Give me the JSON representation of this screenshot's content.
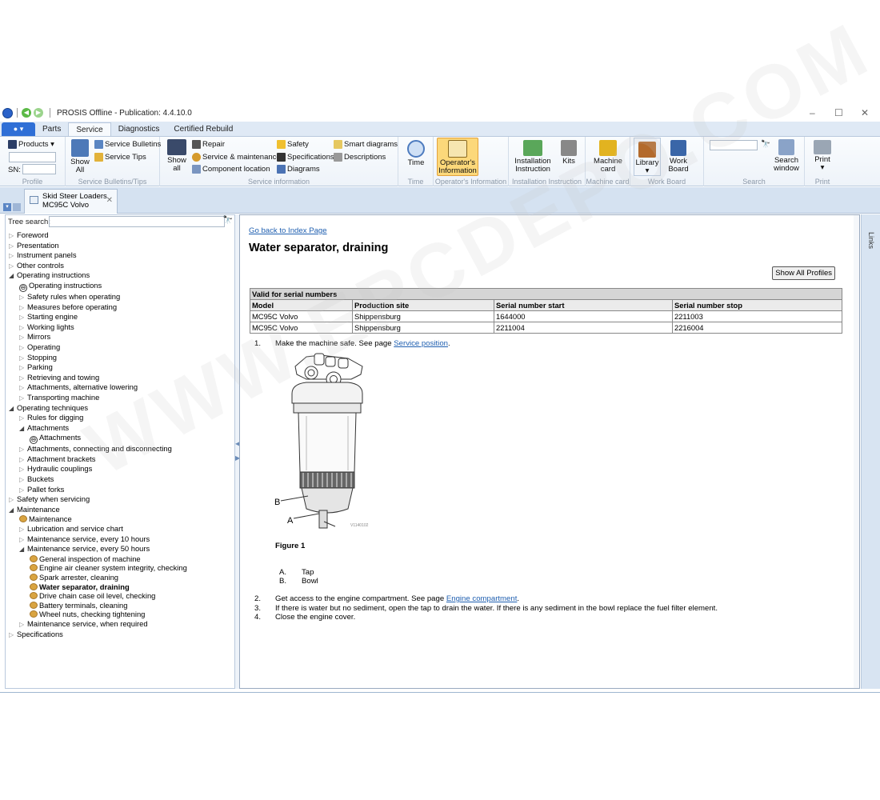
{
  "titlebar": {
    "title": "PROSIS Offline - Publication: 4.4.10.0"
  },
  "menubar": {
    "tabs": [
      "Parts",
      "Service",
      "Diagnostics",
      "Certified Rebuild"
    ],
    "active": "Service"
  },
  "ribbon": {
    "profile": {
      "products_label": "Products",
      "sn_label": "SN:",
      "group_label": "Profile"
    },
    "bulletins": {
      "show_all": "Show All",
      "service_bulletins": "Service Bulletins",
      "service_tips": "Service Tips",
      "group_label": "Service Bulletins/Tips"
    },
    "service_info": {
      "show_all": "Show all",
      "repair": "Repair",
      "service_maintenance": "Service & maintenance",
      "component_location": "Component location",
      "safety": "Safety",
      "specifications": "Specifications",
      "diagrams": "Diagrams",
      "smart_diagrams": "Smart diagrams",
      "descriptions": "Descriptions",
      "group_label": "Service information"
    },
    "time": {
      "label": "Time",
      "group_label": "Time"
    },
    "operators": {
      "label": "Operator's Information",
      "group_label": "Operator's Information"
    },
    "installation": {
      "label": "Installation Instruction",
      "kits": "Kits",
      "group_label": "Installation Instruction"
    },
    "machine_card": {
      "label": "Machine card",
      "group_label": "Machine card"
    },
    "work_board": {
      "library": "Library",
      "label": "Work Board",
      "group_label": "Work Board"
    },
    "search": {
      "window": "Search window",
      "group_label": "Search"
    },
    "print": {
      "label": "Print",
      "group_label": "Print"
    }
  },
  "doctab": {
    "line1": "Skid Steer Loaders",
    "line2": "MC95C Volvo"
  },
  "tree": {
    "search_label": "Tree search:",
    "nodes": [
      {
        "label": "Foreword",
        "level": 0,
        "arrow": "closed"
      },
      {
        "label": "Presentation",
        "level": 0,
        "arrow": "closed"
      },
      {
        "label": "Instrument panels",
        "level": 0,
        "arrow": "closed"
      },
      {
        "label": "Other controls",
        "level": 0,
        "arrow": "closed"
      },
      {
        "label": "Operating instructions",
        "level": 0,
        "arrow": "open"
      },
      {
        "label": "Operating instructions",
        "level": 1,
        "arrow": "circ"
      },
      {
        "label": "Safety rules when operating",
        "level": 1,
        "arrow": "closed"
      },
      {
        "label": "Measures before operating",
        "level": 1,
        "arrow": "closed"
      },
      {
        "label": "Starting engine",
        "level": 1,
        "arrow": "closed"
      },
      {
        "label": "Working lights",
        "level": 1,
        "arrow": "closed"
      },
      {
        "label": "Mirrors",
        "level": 1,
        "arrow": "closed"
      },
      {
        "label": "Operating",
        "level": 1,
        "arrow": "closed"
      },
      {
        "label": "Stopping",
        "level": 1,
        "arrow": "closed"
      },
      {
        "label": "Parking",
        "level": 1,
        "arrow": "closed"
      },
      {
        "label": "Retrieving and towing",
        "level": 1,
        "arrow": "closed"
      },
      {
        "label": "Attachments, alternative lowering",
        "level": 1,
        "arrow": "closed"
      },
      {
        "label": "Transporting machine",
        "level": 1,
        "arrow": "closed"
      },
      {
        "label": "Operating techniques",
        "level": 0,
        "arrow": "open"
      },
      {
        "label": "Rules for digging",
        "level": 1,
        "arrow": "closed"
      },
      {
        "label": "Attachments",
        "level": 1,
        "arrow": "open"
      },
      {
        "label": "Attachments",
        "level": 2,
        "arrow": "circ"
      },
      {
        "label": "Attachments, connecting and disconnecting",
        "level": 1,
        "arrow": "closed"
      },
      {
        "label": "Attachment brackets",
        "level": 1,
        "arrow": "closed"
      },
      {
        "label": "Hydraulic couplings",
        "level": 1,
        "arrow": "closed"
      },
      {
        "label": "Buckets",
        "level": 1,
        "arrow": "closed"
      },
      {
        "label": "Pallet forks",
        "level": 1,
        "arrow": "closed"
      },
      {
        "label": "Safety when servicing",
        "level": 0,
        "arrow": "closed"
      },
      {
        "label": "Maintenance",
        "level": 0,
        "arrow": "open"
      },
      {
        "label": "Maintenance",
        "level": 1,
        "arrow": "doc"
      },
      {
        "label": "Lubrication and service chart",
        "level": 1,
        "arrow": "closed"
      },
      {
        "label": "Maintenance service, every 10 hours",
        "level": 1,
        "arrow": "closed"
      },
      {
        "label": "Maintenance service, every 50 hours",
        "level": 1,
        "arrow": "open"
      },
      {
        "label": "General inspection of machine",
        "level": 2,
        "arrow": "doc"
      },
      {
        "label": "Engine air cleaner system integrity, checking",
        "level": 2,
        "arrow": "doc"
      },
      {
        "label": "Spark arrester, cleaning",
        "level": 2,
        "arrow": "doc"
      },
      {
        "label": "Water separator, draining",
        "level": 2,
        "arrow": "doc",
        "selected": true
      },
      {
        "label": "Drive chain case oil level, checking",
        "level": 2,
        "arrow": "doc"
      },
      {
        "label": "Battery terminals, cleaning",
        "level": 2,
        "arrow": "doc"
      },
      {
        "label": "Wheel nuts, checking tightening",
        "level": 2,
        "arrow": "doc"
      },
      {
        "label": "Maintenance service, when required",
        "level": 1,
        "arrow": "closed"
      },
      {
        "label": "Specifications",
        "level": 0,
        "arrow": "closed"
      }
    ]
  },
  "content": {
    "back_link": "Go back to Index Page",
    "title": "Water separator, draining",
    "show_profiles": "Show All Profiles",
    "table": {
      "caption": "Valid for serial numbers",
      "headers": [
        "Model",
        "Production site",
        "Serial number start",
        "Serial number stop"
      ],
      "rows": [
        [
          "MC95C Volvo",
          "Shippensburg",
          "1644000",
          "2211003"
        ],
        [
          "MC95C Volvo",
          "Shippensburg",
          "2211004",
          "2216004"
        ]
      ]
    },
    "step1": {
      "num": "1.",
      "text": "Make the machine safe. See page ",
      "link": "Service position",
      "after": "."
    },
    "figure": {
      "caption": "Figure 1",
      "code": "V1140102",
      "label_a": "A",
      "label_b": "B"
    },
    "legend": [
      {
        "key": "A.",
        "text": "Tap"
      },
      {
        "key": "B.",
        "text": "Bowl"
      }
    ],
    "step2": {
      "num": "2.",
      "text": "Get access to the engine compartment. See page ",
      "link": "Engine compartment",
      "after": "."
    },
    "step3": {
      "num": "3.",
      "text": "If there is water but no sediment, open the tap to drain the water. If there is any sediment in the bowl replace the fuel filter element."
    },
    "step4": {
      "num": "4.",
      "text": "Close the engine cover."
    }
  },
  "sidebar": {
    "links": "Links"
  },
  "watermark": "WWW.EPCDEPO.COM"
}
